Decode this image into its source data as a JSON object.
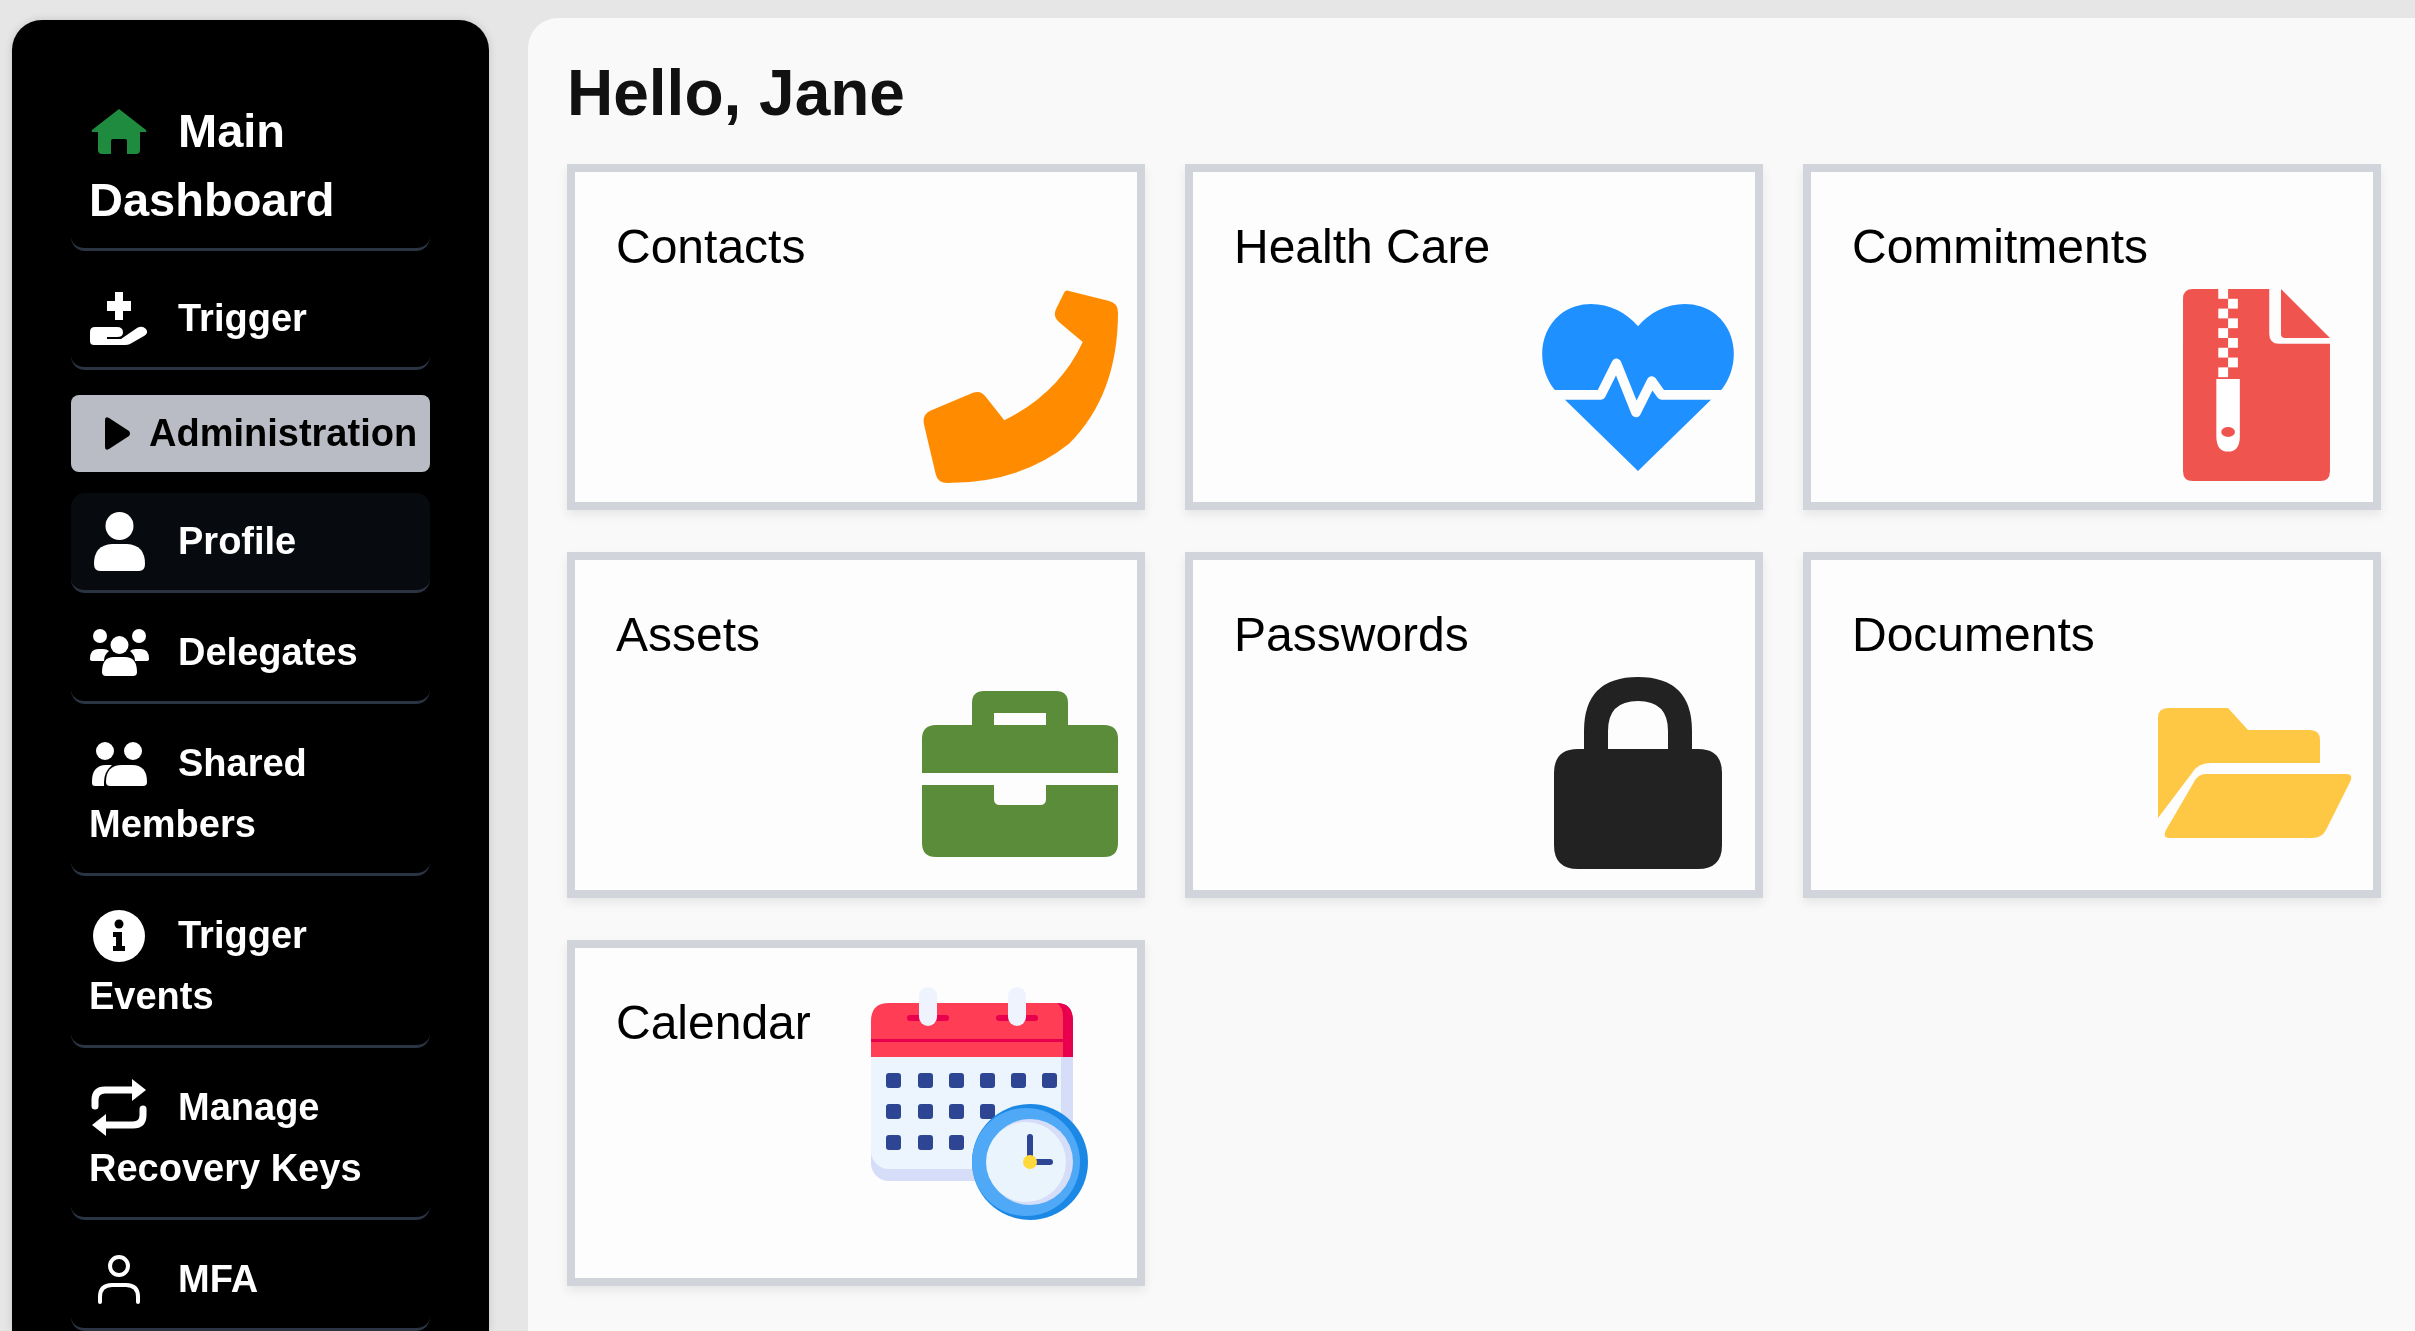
{
  "sidebar": {
    "home_link": {
      "label": "Main Dashboard"
    },
    "items": [
      {
        "kind": "link",
        "label": "Trigger",
        "selected": false,
        "highlighted": false
      },
      {
        "kind": "group",
        "label": "Administration",
        "expanded": false,
        "selected": true,
        "highlighted": false
      },
      {
        "kind": "link",
        "label": "Profile",
        "selected": false,
        "highlighted": true
      },
      {
        "kind": "link",
        "label": "Delegates",
        "selected": false,
        "highlighted": false
      },
      {
        "kind": "link",
        "label": "Shared Members",
        "selected": false,
        "highlighted": false
      },
      {
        "kind": "link",
        "label": "Trigger Events",
        "selected": false,
        "highlighted": false
      },
      {
        "kind": "link",
        "label": "Manage Recovery Keys",
        "selected": false,
        "highlighted": false
      },
      {
        "kind": "link",
        "label": "MFA",
        "selected": false,
        "highlighted": false
      }
    ]
  },
  "content": {
    "greeting": "Hello, Jane",
    "cards": [
      {
        "title": "Contacts"
      },
      {
        "title": "Health Care"
      },
      {
        "title": "Commitments"
      },
      {
        "title": "Assets"
      },
      {
        "title": "Passwords"
      },
      {
        "title": "Documents"
      },
      {
        "title": "Calendar"
      }
    ]
  }
}
